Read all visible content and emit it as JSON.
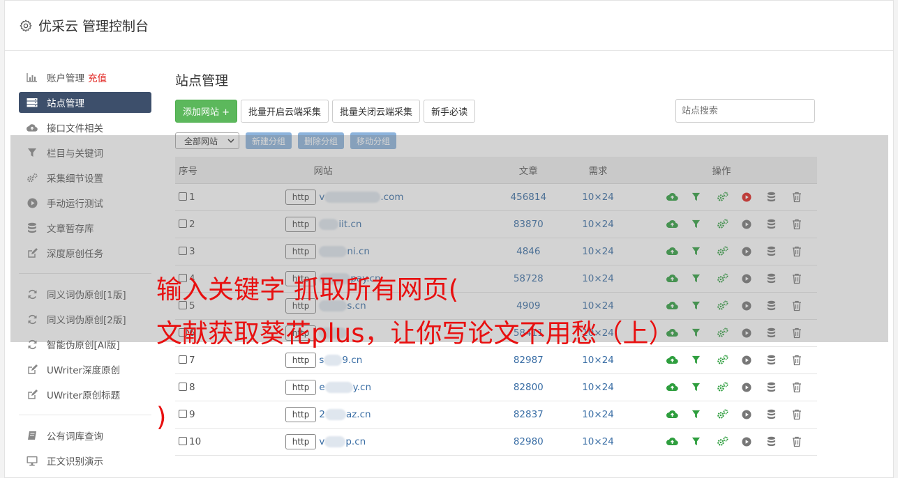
{
  "header": {
    "title": "优采云 管理控制台"
  },
  "sidebar": {
    "items": [
      {
        "label": "账户管理",
        "extra": "充值",
        "icon": "bar-chart-icon"
      },
      {
        "label": "站点管理",
        "icon": "server-icon",
        "active": true
      },
      {
        "label": "接口文件相关",
        "icon": "cloud-upload-icon"
      },
      {
        "label": "栏目与关键词",
        "icon": "filter-icon"
      },
      {
        "label": "采集细节设置",
        "icon": "gears-icon"
      },
      {
        "label": "手动运行测试",
        "icon": "play-circle-icon"
      },
      {
        "label": "文章暂存库",
        "icon": "database-icon"
      },
      {
        "label": "深度原创任务",
        "icon": "edit-icon"
      }
    ],
    "items2": [
      {
        "label": "同义词伪原创[1版]",
        "icon": "refresh-icon"
      },
      {
        "label": "同义词伪原创[2版]",
        "icon": "refresh-icon"
      },
      {
        "label": "智能伪原创[AI版]",
        "icon": "refresh-icon"
      },
      {
        "label": "UWriter深度原创",
        "icon": "edit-icon"
      },
      {
        "label": "UWriter原创标题",
        "icon": "edit-icon"
      }
    ],
    "items3": [
      {
        "label": "公有词库查询",
        "icon": "book-icon"
      },
      {
        "label": "正文识别演示",
        "icon": "monitor-icon"
      }
    ]
  },
  "main": {
    "title": "站点管理",
    "buttons": {
      "add": "添加网站 +",
      "open": "批量开启云端采集",
      "close": "批量关闭云端采集",
      "guide": "新手必读"
    },
    "search_placeholder": "站点搜索",
    "group_select": "全部网站",
    "group_buttons": {
      "new": "新建分组",
      "delete": "删除分组",
      "move": "移动分组"
    },
    "table": {
      "headers": {
        "num": "序号",
        "site": "网站",
        "articles": "文章",
        "demand": "需求",
        "ops": "操作"
      },
      "http_label": "http",
      "rows": [
        {
          "num": "1",
          "prefix": "v",
          "suffix": ".com",
          "articles": "456814",
          "demand": "10×24",
          "running": true
        },
        {
          "num": "2",
          "prefix": "",
          "suffix": "iit.cn",
          "articles": "83870",
          "demand": "10×24",
          "running": false
        },
        {
          "num": "3",
          "prefix": "",
          "suffix": "ni.cn",
          "articles": "4846",
          "demand": "10×24",
          "running": false
        },
        {
          "num": "4",
          "prefix": "",
          "suffix": "pay.cn",
          "articles": "58728",
          "demand": "10×24",
          "running": false
        },
        {
          "num": "5",
          "prefix": "",
          "suffix": "s.cn",
          "articles": "4909",
          "demand": "10×24",
          "running": false
        },
        {
          "num": "6",
          "prefix": "",
          "suffix": "",
          "articles": "58411",
          "demand": "10×24",
          "running": false
        },
        {
          "num": "7",
          "prefix": "s",
          "suffix": "9.cn",
          "articles": "82987",
          "demand": "10×24",
          "running": false
        },
        {
          "num": "8",
          "prefix": "e",
          "suffix": "y.cn",
          "articles": "82800",
          "demand": "10×24",
          "running": false
        },
        {
          "num": "9",
          "prefix": "2",
          "suffix": "az.cn",
          "articles": "82837",
          "demand": "10×24",
          "running": false
        },
        {
          "num": "10",
          "prefix": "v",
          "suffix": "p.cn",
          "articles": "82980",
          "demand": "10×24",
          "running": false
        }
      ]
    }
  },
  "watermark": {
    "line1": "输入关键字 抓取所有网页(",
    "line2": "文献获取葵花plus，让你写论文不用愁（上）",
    "line3": ")"
  },
  "colors": {
    "accent_green": "#5cb85c",
    "nav_active": "#3d4f6b",
    "link_blue": "#3a6ea5",
    "watermark_red": "#e81010",
    "stop_red": "#e0201c"
  }
}
